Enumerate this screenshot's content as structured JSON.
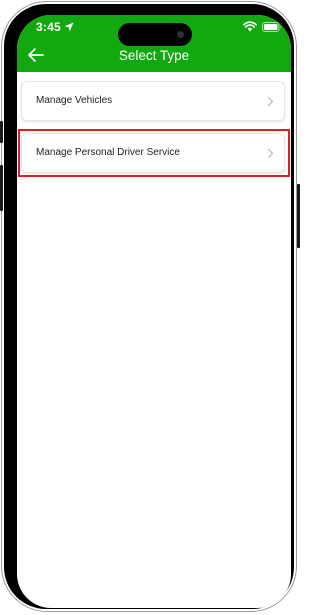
{
  "status_bar": {
    "time": "3:45",
    "location_icon": "location-arrow-icon",
    "wifi_icon": "wifi-icon",
    "battery_icon": "battery-icon"
  },
  "header": {
    "title": "Select Type",
    "back_icon": "back-arrow-icon",
    "background_color": "#12a80f"
  },
  "options": [
    {
      "label": "Manage Vehicles",
      "icon": "chevron-right-icon",
      "highlighted": false
    },
    {
      "label": "Manage Personal Driver Service",
      "icon": "chevron-right-icon",
      "highlighted": true
    }
  ],
  "highlight_color": "#e01e26"
}
